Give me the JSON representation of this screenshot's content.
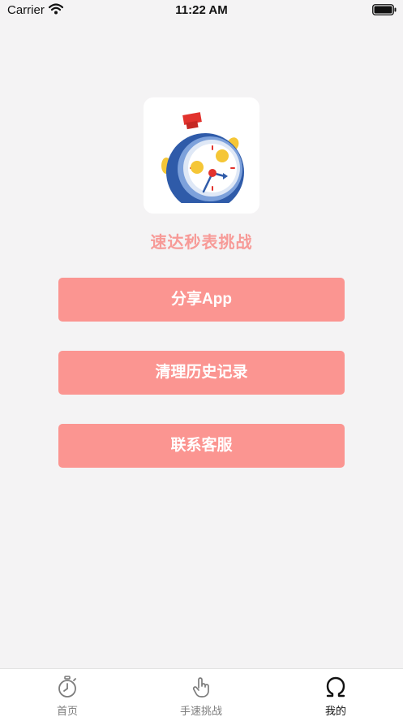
{
  "status_bar": {
    "carrier": "Carrier",
    "time": "11:22 AM"
  },
  "app": {
    "title": "速达秒表挑战",
    "icon": "stopwatch-logo"
  },
  "actions": {
    "share_label": "分享App",
    "clear_history_label": "清理历史记录",
    "contact_label": "联系客服"
  },
  "tabs": [
    {
      "label": "首页",
      "icon": "stopwatch-icon",
      "active": false
    },
    {
      "label": "手速挑战",
      "icon": "hand-pointer-icon",
      "active": false
    },
    {
      "label": "我的",
      "icon": "omega-icon",
      "active": true
    }
  ],
  "colors": {
    "accent": "#fb9591",
    "title": "#f79a97",
    "background": "#f4f3f4"
  }
}
